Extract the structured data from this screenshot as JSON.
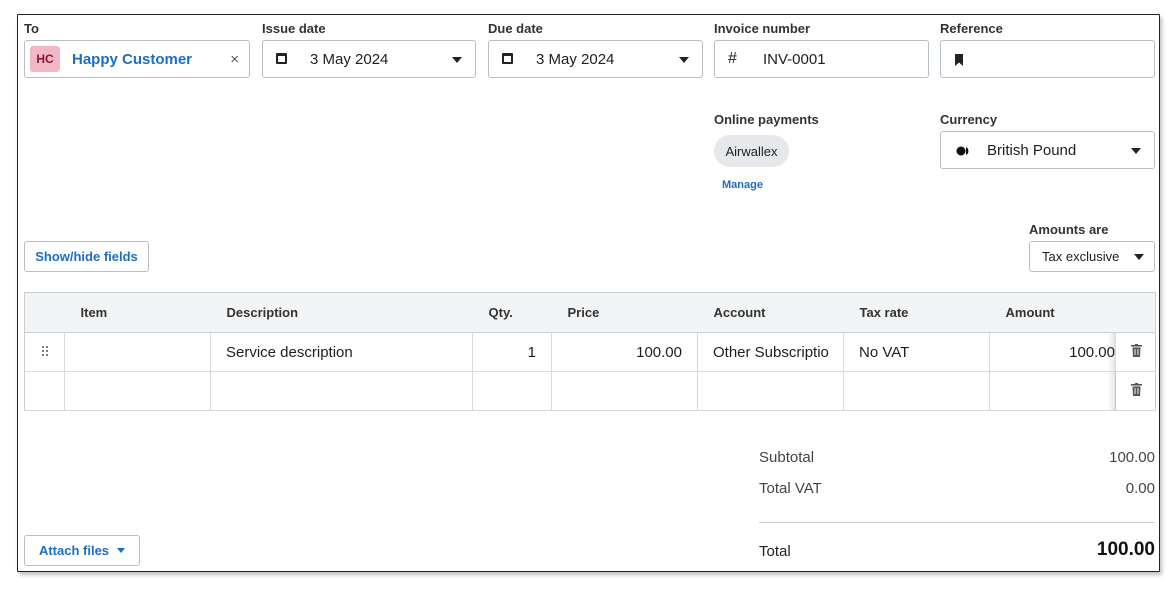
{
  "to": {
    "label": "To",
    "initials": "HC",
    "name": "Happy Customer",
    "clear_icon": "×"
  },
  "issue_date": {
    "label": "Issue date",
    "value": "3 May 2024"
  },
  "due_date": {
    "label": "Due date",
    "value": "3 May 2024"
  },
  "invoice_number": {
    "label": "Invoice number",
    "prefix": "#",
    "value": "INV-0001"
  },
  "reference": {
    "label": "Reference",
    "value": ""
  },
  "online_payments": {
    "label": "Online payments",
    "provider": "Airwallex",
    "manage": "Manage"
  },
  "currency": {
    "label": "Currency",
    "value": "British Pound"
  },
  "amounts_are": {
    "label": "Amounts are",
    "value": "Tax exclusive"
  },
  "show_hide_fields": "Show/hide fields",
  "table": {
    "headers": [
      "Item",
      "Description",
      "Qty.",
      "Price",
      "Account",
      "Tax rate",
      "Amount"
    ],
    "rows": [
      {
        "item": "",
        "description": "Service description",
        "qty": "1",
        "price": "100.00",
        "account": "Other Subscriptio",
        "tax_rate": "No VAT",
        "amount": "100.00"
      },
      {
        "item": "",
        "description": "",
        "qty": "",
        "price": "",
        "account": "",
        "tax_rate": "",
        "amount": ""
      }
    ]
  },
  "totals": {
    "subtotal_label": "Subtotal",
    "subtotal": "100.00",
    "vat_label": "Total VAT",
    "vat": "0.00",
    "total_label": "Total",
    "total": "100.00"
  },
  "attach_files": "Attach files",
  "colors": {
    "accent": "#1d6dc4",
    "avatar_bg": "#f2b8c6",
    "avatar_text": "#8a1730"
  }
}
